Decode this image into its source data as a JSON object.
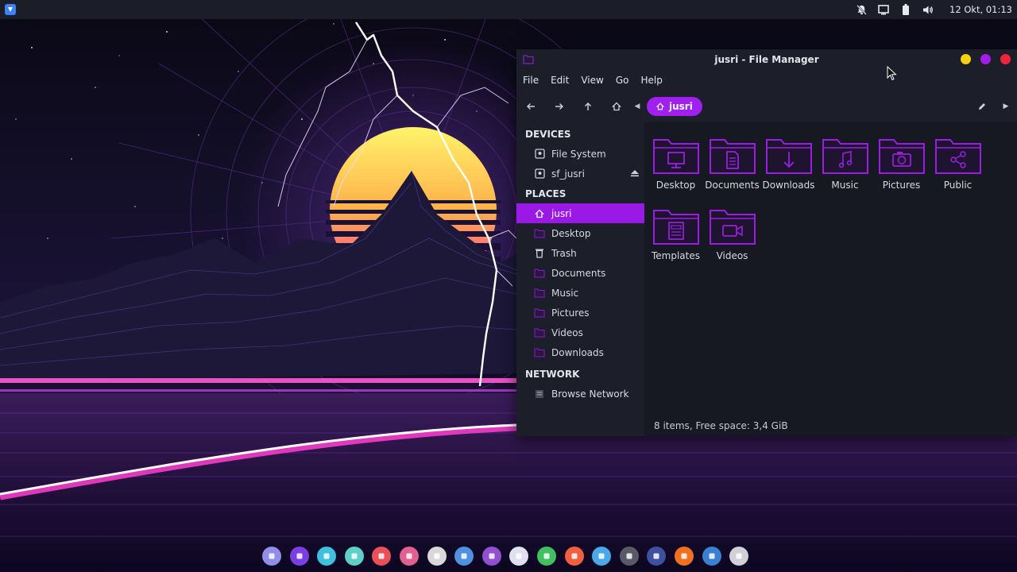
{
  "top_panel": {
    "clock": "12 Okt, 01:13",
    "tray_icons": [
      "notifications-off-icon",
      "display-icon",
      "battery-icon",
      "volume-icon"
    ]
  },
  "window": {
    "title": "jusri - File Manager",
    "buttons": [
      {
        "name": "minimize",
        "color": "#f6d10c"
      },
      {
        "name": "maximize",
        "color": "#a11ee8"
      },
      {
        "name": "close",
        "color": "#f0243a"
      }
    ]
  },
  "menu": [
    "File",
    "Edit",
    "View",
    "Go",
    "Help"
  ],
  "toolbar": {
    "path_crumb": "jusri"
  },
  "sidebar": {
    "devices_header": "DEVICES",
    "devices": [
      {
        "label": "File System",
        "icon": "drive-icon"
      },
      {
        "label": "sf_jusri",
        "icon": "drive-icon"
      }
    ],
    "places_header": "PLACES",
    "places": [
      {
        "label": "jusri",
        "icon": "home-icon",
        "active": true
      },
      {
        "label": "Desktop",
        "icon": "folder-icon"
      },
      {
        "label": "Trash",
        "icon": "trash-icon"
      },
      {
        "label": "Documents",
        "icon": "folder-icon"
      },
      {
        "label": "Music",
        "icon": "folder-icon"
      },
      {
        "label": "Pictures",
        "icon": "folder-icon"
      },
      {
        "label": "Videos",
        "icon": "folder-icon"
      },
      {
        "label": "Downloads",
        "icon": "folder-icon"
      }
    ],
    "network_header": "NETWORK",
    "network": [
      {
        "label": "Browse Network",
        "icon": "network-icon"
      }
    ]
  },
  "content": {
    "items": [
      {
        "label": "Desktop",
        "icon": "desktop-folder-icon"
      },
      {
        "label": "Documents",
        "icon": "documents-folder-icon"
      },
      {
        "label": "Downloads",
        "icon": "downloads-folder-icon"
      },
      {
        "label": "Music",
        "icon": "music-folder-icon"
      },
      {
        "label": "Pictures",
        "icon": "pictures-folder-icon"
      },
      {
        "label": "Public",
        "icon": "public-folder-icon"
      },
      {
        "label": "Templates",
        "icon": "templates-folder-icon"
      },
      {
        "label": "Videos",
        "icon": "videos-folder-icon"
      }
    ],
    "status": "8 items, Free space: 3,4 GiB"
  },
  "colors": {
    "accent": "#a020f0",
    "folder_stroke": "#9a1ee0",
    "window_bg": "#1c1e29",
    "content_bg": "#161822"
  },
  "dock": [
    {
      "name": "app-grid-icon",
      "color": "#8f8fe8"
    },
    {
      "name": "moon-icon",
      "color": "#7a3fe0"
    },
    {
      "name": "mail-icon",
      "color": "#3fc0e0"
    },
    {
      "name": "gamepad-icon",
      "color": "#5fd0c8"
    },
    {
      "name": "download-manager-icon",
      "color": "#e8505a"
    },
    {
      "name": "chat-icon",
      "color": "#e06090"
    },
    {
      "name": "cat-icon",
      "color": "#d8d8d8"
    },
    {
      "name": "finder-icon",
      "color": "#5090e0"
    },
    {
      "name": "font-viewer-icon",
      "color": "#9050d0"
    },
    {
      "name": "document-icon",
      "color": "#e0e0f0"
    },
    {
      "name": "spreadsheet-icon",
      "color": "#40c060"
    },
    {
      "name": "presentation-icon",
      "color": "#f06040"
    },
    {
      "name": "image-viewer-icon",
      "color": "#4aa8e8"
    },
    {
      "name": "terminal-icon",
      "color": "#5a5a66"
    },
    {
      "name": "system-monitor-icon",
      "color": "#4050a0"
    },
    {
      "name": "firefox-icon",
      "color": "#f07020"
    },
    {
      "name": "toggle-icon",
      "color": "#3a80d0"
    },
    {
      "name": "settings-icon",
      "color": "#d0d0d8"
    }
  ]
}
